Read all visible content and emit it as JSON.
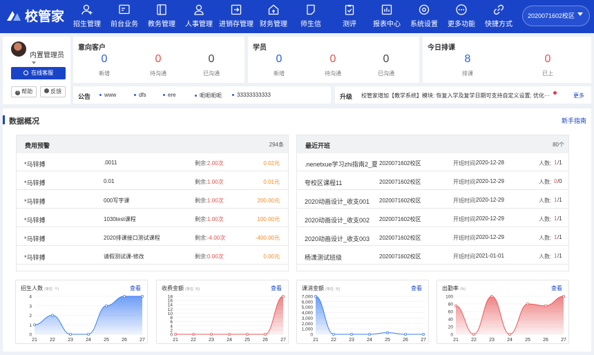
{
  "app": {
    "brand": "校管家",
    "campus": "2020071602校区"
  },
  "nav": [
    {
      "label": "招生管理",
      "icon": "add-user-icon"
    },
    {
      "label": "前台业务",
      "icon": "monitor-icon"
    },
    {
      "label": "教务管理",
      "icon": "book-icon"
    },
    {
      "label": "人事管理",
      "icon": "person-icon"
    },
    {
      "label": "进销存管理",
      "icon": "inventory-icon"
    },
    {
      "label": "财务管理",
      "icon": "finance-icon"
    },
    {
      "label": "师生信",
      "icon": "message-icon"
    },
    {
      "label": "测评",
      "icon": "clipboard-icon"
    },
    {
      "label": "报表中心",
      "icon": "report-icon"
    },
    {
      "label": "系统设置",
      "icon": "settings-icon"
    },
    {
      "label": "更多功能",
      "icon": "more-icon"
    },
    {
      "label": "快捷方式",
      "icon": "link-icon"
    }
  ],
  "profile": {
    "name": "内置管理员",
    "online_service": "在线客服",
    "help": "帮助",
    "feedback": "反馈"
  },
  "leads": {
    "title": "意向客户",
    "stats": [
      {
        "value": "0",
        "caption": "新增",
        "color": "blue"
      },
      {
        "value": "0",
        "caption": "待沟通",
        "color": "red"
      },
      {
        "value": "0",
        "caption": "已沟通",
        "color": "gray"
      }
    ]
  },
  "students": {
    "title": "学员",
    "stats": [
      {
        "value": "0",
        "caption": "新增",
        "color": "blue"
      },
      {
        "value": "0",
        "caption": "待沟通",
        "color": "red"
      },
      {
        "value": "0",
        "caption": "已沟通",
        "color": "gray"
      }
    ]
  },
  "today": {
    "title": "今日排课",
    "stats": [
      {
        "value": "8",
        "caption": "排课",
        "color": "blue"
      },
      {
        "value": "0",
        "caption": "已上",
        "color": "red"
      }
    ]
  },
  "notice": {
    "label": "公告",
    "items": [
      "www",
      "dfs",
      "ere",
      "呃呃呃呃",
      "33333333333"
    ]
  },
  "upgrade": {
    "label": "升级",
    "text": "校管家增加【教学系统】模块: 恢复入学及复学日期可支持自定义设置; 优化···",
    "more": "更多"
  },
  "overview": {
    "title": "数据概况",
    "guide": "新手指南"
  },
  "fee_alert": {
    "title": "费用预警",
    "count": "294条",
    "remain_label": "剩余:",
    "rows": [
      {
        "name": "*马锌搏",
        "course": ".0011",
        "remain": "2.00次",
        "amount": "0.02元"
      },
      {
        "name": "*马锌搏",
        "course": "0.01",
        "remain": "1.00次",
        "amount": "0.01元"
      },
      {
        "name": "*马锌搏",
        "course": "000写字课",
        "remain": "1.00次",
        "amount": "200.00元"
      },
      {
        "name": "*马锌搏",
        "course": "1030test课程",
        "remain": "1.00次",
        "amount": "100.00元"
      },
      {
        "name": "*马锌搏",
        "course": "2020排课接口测试课程",
        "remain": "-4.00次",
        "amount": "-400.00元"
      },
      {
        "name": "*马锌搏",
        "course": "请假测试课-修改",
        "remain": "0.00次",
        "amount": "0.00元"
      }
    ]
  },
  "recent_classes": {
    "title": "最近开班",
    "count": "80个",
    "time_label": "开班时间:",
    "people_label": "人数:",
    "rows": [
      {
        "name": ".nenetxue学习zhi指南2_夏天···",
        "campus": "2020071602校区",
        "date": "2020-12-28",
        "count": "1",
        "total": "/1"
      },
      {
        "name": "夸校区课程11",
        "campus": "2020071602校区",
        "date": "2020-12-29",
        "count": "0",
        "total": "/0"
      },
      {
        "name": "2020动画设计_收支001",
        "campus": "2020071602校区",
        "date": "2020-12-29",
        "count": "1",
        "total": "/1"
      },
      {
        "name": "2020动画设计_收支002",
        "campus": "2020071602校区",
        "date": "2020-12-29",
        "count": "1",
        "total": "/1"
      },
      {
        "name": "2020动画设计_收支003",
        "campus": "2020071602校区",
        "date": "2020-12-29",
        "count": "1",
        "total": "/1"
      },
      {
        "name": "杨潇测试班级",
        "campus": "2020071602校区",
        "date": "2021-01-01",
        "count": "1",
        "total": "/1"
      }
    ]
  },
  "view_label": "查看",
  "chart_data": [
    {
      "type": "area",
      "title": "招生人数",
      "unit": "(单位: 个)",
      "x": [
        "21",
        "22",
        "23",
        "24",
        "25",
        "26",
        "27"
      ],
      "yticks": [
        "0",
        "1",
        "2",
        "3",
        "4"
      ],
      "ylim": [
        0,
        4
      ],
      "values": [
        1,
        2,
        0,
        0,
        3,
        4,
        4
      ],
      "color": "#3b7cf2",
      "grid": true
    },
    {
      "type": "area",
      "title": "收费金额",
      "unit": "(单位: 元)",
      "x": [
        "21",
        "22",
        "23",
        "24",
        "25",
        "26",
        "27"
      ],
      "yticks": [
        "0",
        "2",
        "4",
        "6",
        "8",
        "10",
        "12",
        "14",
        "16",
        "18"
      ],
      "ylim": [
        0,
        18
      ],
      "values": [
        0,
        0,
        0,
        0,
        0,
        0,
        18
      ],
      "color": "#e8585a",
      "grid": true
    },
    {
      "type": "area",
      "title": "课消金额",
      "unit": "(单位: 元)",
      "x": [
        "21",
        "22",
        "23",
        "24",
        "25",
        "26",
        "27"
      ],
      "yticks": [
        "0",
        "1,000",
        "2,000",
        "3,000",
        "4,000",
        "5,000",
        "6,000",
        "7,000"
      ],
      "ylim": [
        0,
        7000
      ],
      "values": [
        7000,
        0,
        0,
        0,
        300,
        0,
        0
      ],
      "color": "#3b7cf2",
      "grid": true
    },
    {
      "type": "area",
      "title": "出勤率",
      "unit": "(%)",
      "x": [
        "21",
        "22",
        "23",
        "24",
        "25",
        "26",
        "27"
      ],
      "yticks": [
        "0",
        "20",
        "40",
        "60",
        "80",
        "100"
      ],
      "ylim": [
        0,
        100
      ],
      "values": [
        75,
        0,
        100,
        0,
        80,
        75,
        100
      ],
      "color": "#e8585a",
      "grid": true
    }
  ]
}
